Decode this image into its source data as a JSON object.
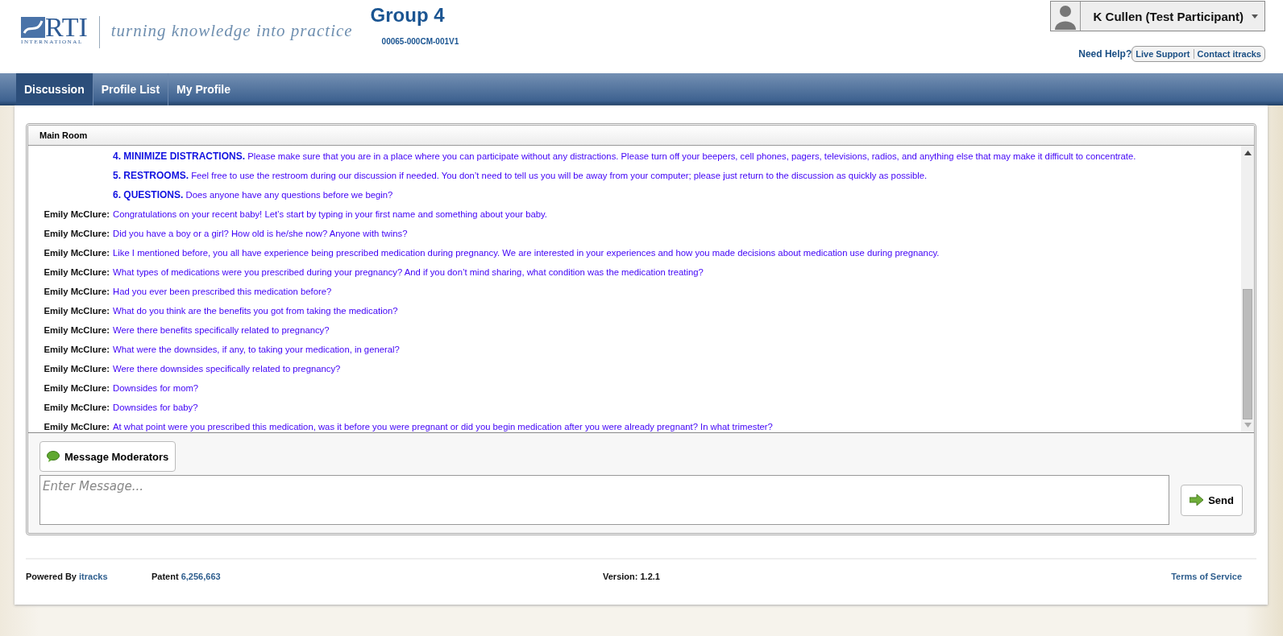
{
  "header": {
    "logo_text": "RTI",
    "logo_subtext": "INTERNATIONAL",
    "tagline": "turning knowledge into practice",
    "group_title": "Group 4",
    "group_code": "00065-000CM-001V1",
    "user_name": "K Cullen (Test Participant)",
    "help_label": "Need Help?",
    "help_links": [
      "Live Support",
      "Contact itracks"
    ]
  },
  "nav": [
    {
      "label": "Discussion",
      "selected": true
    },
    {
      "label": "Profile List",
      "selected": false
    },
    {
      "label": "My Profile",
      "selected": false
    }
  ],
  "room": {
    "title": "Main Room",
    "messages": [
      {
        "text": "**4. MINIMIZE DISTRACTIONS.** Please make sure that you are in a place where you can participate without any distractions. Please turn off your beepers, cell phones, pagers, televisions, radios, and anything else that may make it difficult to concentrate."
      },
      {
        "text": "**5. RESTROOMS.** Feel free to use the restroom during our discussion if needed. You don’t need to tell us you will be away from your computer; please just return to the discussion as quickly as possible."
      },
      {
        "text": "**6. QUESTIONS.** Does anyone have any questions before we begin?"
      },
      {
        "speaker": "Emily McClure:",
        "text": "Congratulations on your recent baby! Let’s start by typing in your first name and something about your baby."
      },
      {
        "speaker": "Emily McClure:",
        "text": "Did you have a boy or a girl? How old is he/she now? Anyone with twins?"
      },
      {
        "speaker": "Emily McClure:",
        "text": "Like I mentioned before, you all have experience being prescribed medication during pregnancy. We are interested in your experiences and how you made decisions about medication use during pregnancy."
      },
      {
        "speaker": "Emily McClure:",
        "text": "What types of medications were you prescribed during your pregnancy? And if you don’t mind sharing, what condition was the medication treating?"
      },
      {
        "speaker": "Emily McClure:",
        "text": "Had you ever been prescribed this medication before?"
      },
      {
        "speaker": "Emily McClure:",
        "text": "What do you think are the benefits you got from taking the medication?"
      },
      {
        "speaker": "Emily McClure:",
        "text": "Were there benefits specifically related to pregnancy?"
      },
      {
        "speaker": "Emily McClure:",
        "text": "What were the downsides, if any, to taking your medication, in general?"
      },
      {
        "speaker": "Emily McClure:",
        "text": "Were there downsides specifically related to pregnancy?"
      },
      {
        "speaker": "Emily McClure:",
        "text": "Downsides for mom?"
      },
      {
        "speaker": "Emily McClure:",
        "text": "Downsides for baby?"
      },
      {
        "speaker": "Emily McClure:",
        "text": "At what point were you prescribed this medication, was it before you were pregnant or did you begin medication after you were already pregnant? In what trimester?"
      }
    ],
    "moderator_button": "Message Moderators",
    "message_placeholder": "Enter Message...",
    "send_button": "Send"
  },
  "footer": {
    "powered_label": "Powered By",
    "powered_link": "itracks",
    "patent_label": "Patent",
    "patent_link": "6,256,663",
    "version": "Version: 1.2.1",
    "terms": "Terms of Service"
  }
}
